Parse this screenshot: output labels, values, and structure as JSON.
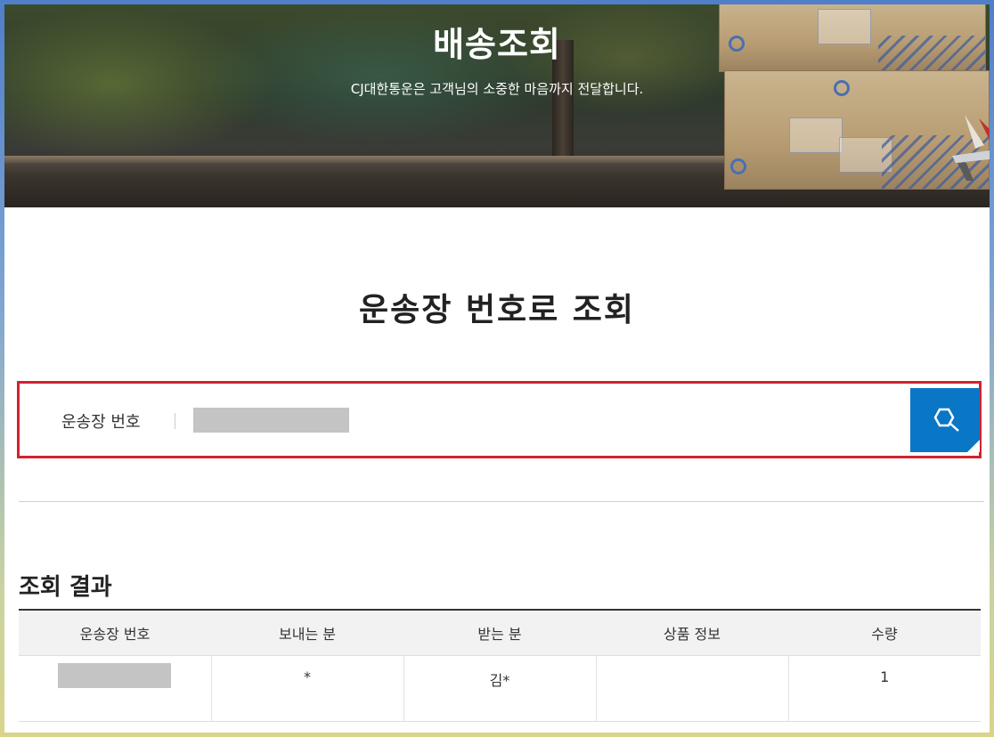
{
  "hero": {
    "title": "배송조회",
    "subtitle": "CJ대한통운은 고객님의 소중한 마음까지 전달합니다."
  },
  "section_title": "운송장 번호로 조회",
  "search": {
    "label": "운송장 번호",
    "value": "",
    "button_icon": "search-icon"
  },
  "results": {
    "title": "조회 결과",
    "columns": [
      "운송장 번호",
      "보내는 분",
      "받는 분",
      "상품 정보",
      "수량"
    ],
    "rows": [
      {
        "tracking_number": "",
        "sender": "*",
        "receiver": "김*",
        "product": "",
        "quantity": "1"
      }
    ]
  },
  "colors": {
    "accent_blue": "#0a76c6",
    "highlight_red": "#d1222f",
    "masked_gray": "#c4c4c4"
  }
}
